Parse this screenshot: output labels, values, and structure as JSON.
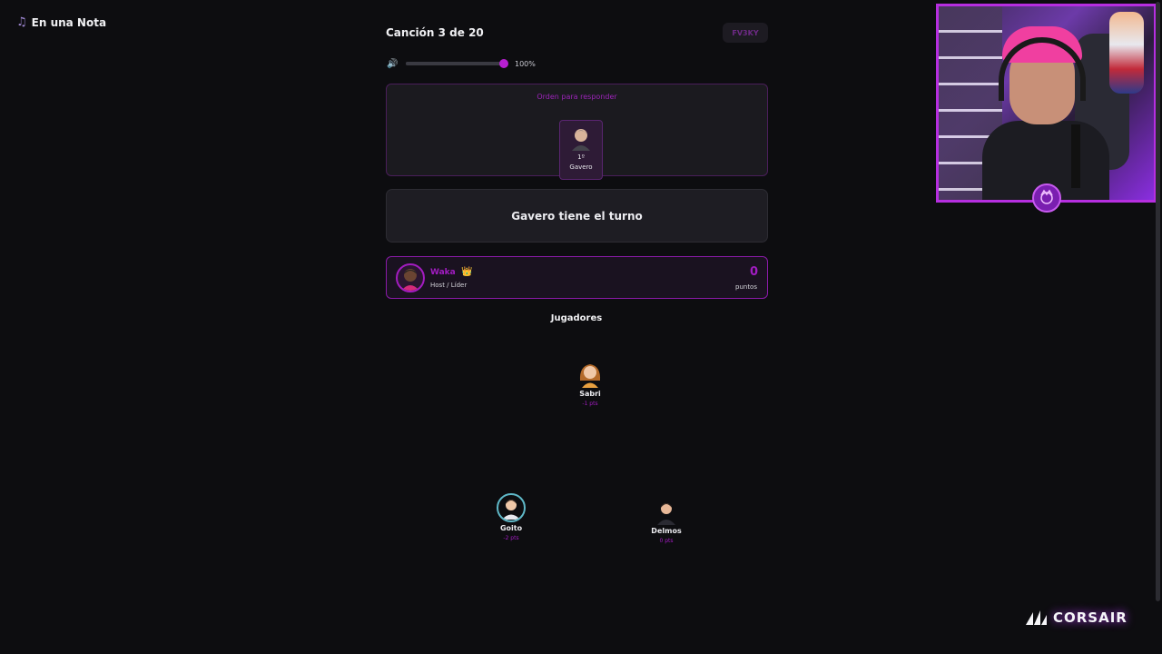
{
  "app": {
    "title": "En una Nota"
  },
  "header": {
    "song_progress": "Canción 3 de 20",
    "room_code": "FV3KY"
  },
  "volume": {
    "level": 1.0,
    "label": "100%"
  },
  "order_panel": {
    "label": "Orden para responder",
    "entries": [
      {
        "position": "1º",
        "name": "Gavero"
      }
    ]
  },
  "turn": {
    "message": "Gavero tiene el turno"
  },
  "host": {
    "name": "Waka",
    "role": "Host / Líder",
    "points": "0",
    "points_label": "puntos"
  },
  "players": {
    "title": "Jugadores",
    "list": [
      {
        "name": "Sabri",
        "points": "-1 pts"
      },
      {
        "name": "Goito",
        "points": "-2 pts"
      },
      {
        "name": "Delmos",
        "points": "0 pts"
      }
    ]
  },
  "sponsor": {
    "name": "CORSAIR"
  },
  "colors": {
    "accent": "#a21cc2",
    "background": "#0d0d10",
    "panel": "#1e1d23"
  }
}
